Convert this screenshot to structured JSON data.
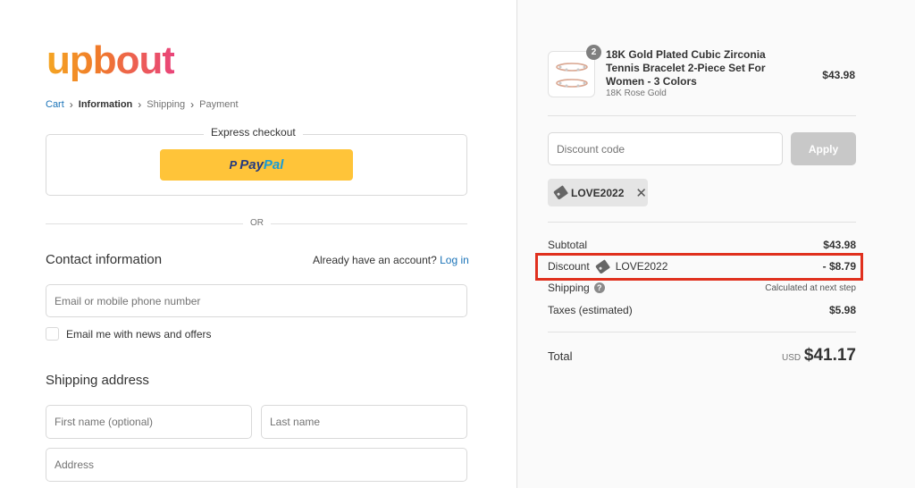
{
  "brand": {
    "logo_text": "upbout"
  },
  "breadcrumb": {
    "items": [
      "Cart",
      "Information",
      "Shipping",
      "Payment"
    ]
  },
  "express": {
    "title": "Express checkout",
    "paypal_first": "Pay",
    "paypal_second": "Pal",
    "or_text": "OR"
  },
  "contact": {
    "title": "Contact information",
    "account_prompt": "Already have an account?",
    "login_link": "Log in",
    "email_placeholder": "Email or mobile phone number",
    "newsletter_label": "Email me with news and offers"
  },
  "shipping_address": {
    "title": "Shipping address",
    "first_name_placeholder": "First name (optional)",
    "last_name_placeholder": "Last name",
    "address_placeholder": "Address"
  },
  "order": {
    "product": {
      "name": "18K Gold Plated Cubic Zirconia Tennis Bracelet 2-Piece Set For Women - 3 Colors",
      "variant": "18K Rose Gold",
      "price": "$43.98",
      "quantity": "2"
    },
    "discount_placeholder": "Discount code",
    "apply_label": "Apply",
    "applied_code": "LOVE2022",
    "subtotal_label": "Subtotal",
    "subtotal_value": "$43.98",
    "discount_label": "Discount",
    "discount_code": "LOVE2022",
    "discount_value": "- $8.79",
    "shipping_label": "Shipping",
    "shipping_value": "Calculated at next step",
    "taxes_label": "Taxes (estimated)",
    "taxes_value": "$5.98",
    "total_label": "Total",
    "currency": "USD",
    "total_value": "$41.17"
  },
  "colors": {
    "link": "#1a73b8",
    "paypal_yellow": "#ffc439",
    "highlight": "#e0301e",
    "apply_disabled": "#c8c8c8"
  }
}
